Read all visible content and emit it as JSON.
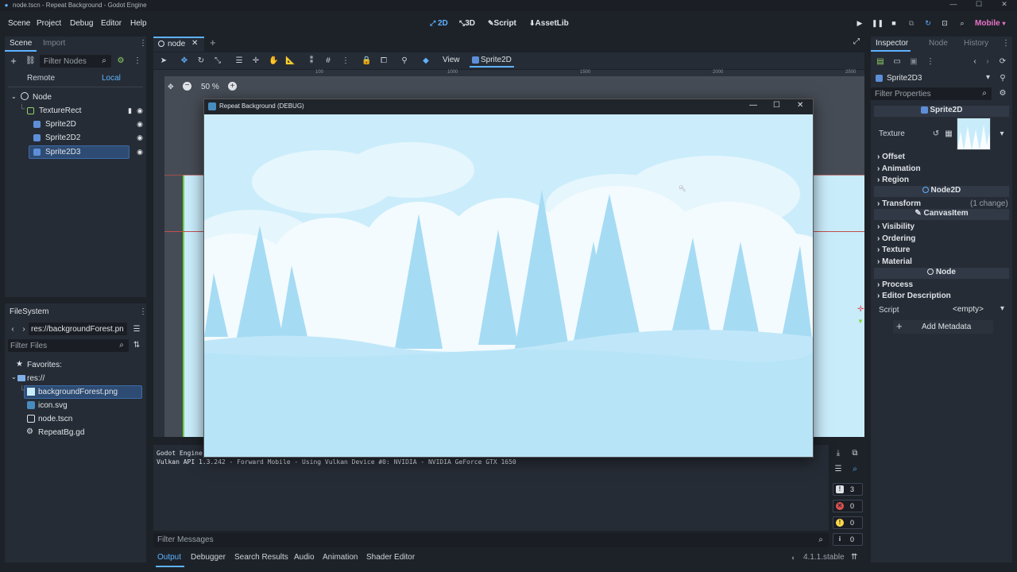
{
  "window": {
    "title": "node.tscn - Repeat Background - Godot Engine",
    "minimize": "—",
    "maximize": "☐",
    "close": "✕"
  },
  "menu": [
    "Scene",
    "Project",
    "Debug",
    "Editor",
    "Help"
  ],
  "modes": {
    "m2d": "2D",
    "m3d": "3D",
    "script": "Script",
    "assetlib": "AssetLib"
  },
  "renderer": "Mobile",
  "scene_dock": {
    "tabs": [
      "Scene",
      "Import"
    ],
    "filter_placeholder": "Filter Nodes",
    "remote": "Remote",
    "local": "Local",
    "nodes": [
      "Node",
      "TextureRect",
      "Sprite2D",
      "Sprite2D2",
      "Sprite2D3"
    ]
  },
  "filesystem": {
    "title": "FileSystem",
    "path": "res://backgroundForest.pn",
    "filter_placeholder": "Filter Files",
    "favorites": "Favorites:",
    "root": "res://",
    "files": [
      "backgroundForest.png",
      "icon.svg",
      "node.tscn",
      "RepeatBg.gd"
    ]
  },
  "editor": {
    "scene_tab": "node",
    "view_menu": "View",
    "sprite_btn": "Sprite2D",
    "zoom": "50 %",
    "ruler": [
      "100",
      "1000",
      "1500",
      "2000",
      "2500"
    ]
  },
  "game_window": {
    "title": "Repeat Background (DEBUG)"
  },
  "output": {
    "line1": "Godot Engine",
    "line2": "Vulkan API 1.3.242 - Forward Mobile - Using Vulkan Device #0: NVIDIA - NVIDIA GeForce GTX 1650",
    "filter_placeholder": "Filter Messages",
    "counts": {
      "messages": "3",
      "errors": "0",
      "warnings": "0",
      "info": "0"
    }
  },
  "bottom_tabs": [
    "Output",
    "Debugger",
    "Search Results",
    "Audio",
    "Animation",
    "Shader Editor"
  ],
  "version": "4.1.1.stable",
  "inspector": {
    "tabs": [
      "Inspector",
      "Node",
      "History"
    ],
    "object": "Sprite2D3",
    "filter_placeholder": "Filter Properties",
    "class_sprite": "Sprite2D",
    "texture_label": "Texture",
    "sprite_sections": [
      "Offset",
      "Animation",
      "Region"
    ],
    "class_node2d": "Node2D",
    "transform": "Transform",
    "transform_note": "(1 change)",
    "class_canvasitem": "CanvasItem",
    "canvas_sections": [
      "Visibility",
      "Ordering",
      "Texture",
      "Material"
    ],
    "class_node": "Node",
    "node_sections": [
      "Process",
      "Editor Description"
    ],
    "script_label": "Script",
    "script_value": "<empty>",
    "add_metadata": "Add Metadata"
  },
  "colors": {
    "accent": "#5fb2ff",
    "selection": "#2e4c73",
    "sky": "#c9ecfb",
    "tree": "#a9dcf5",
    "panel": "#262c35",
    "bg": "#1d2229"
  }
}
